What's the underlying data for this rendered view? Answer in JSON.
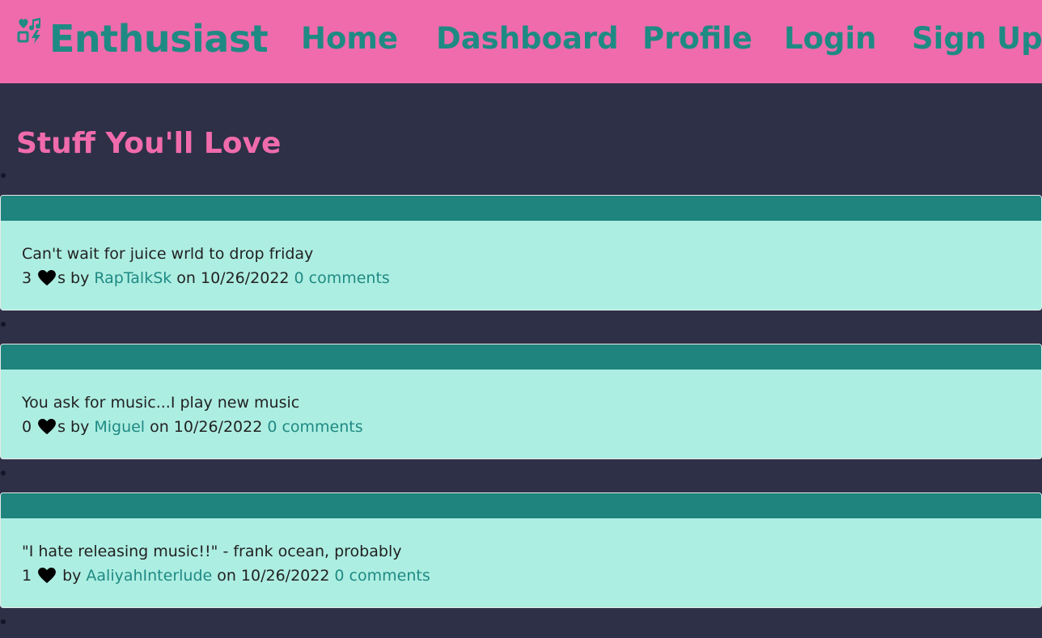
{
  "navbar": {
    "brand": "Enthusiast",
    "links": [
      "Home",
      "Dashboard",
      "Profile",
      "Login",
      "Sign Up"
    ]
  },
  "main": {
    "title": "Stuff You'll Love",
    "posts": [
      {
        "text": "Can't wait for juice wrld to drop friday",
        "likes": "3",
        "likes_suffix": "s by",
        "author": "RapTalkSk",
        "on": "on 10/26/2022",
        "comments": "0 comments"
      },
      {
        "text": "You ask for music...I play new music",
        "likes": "0",
        "likes_suffix": "s by",
        "author": "Miguel",
        "on": "on 10/26/2022",
        "comments": "0 comments"
      },
      {
        "text": "\"I hate releasing music!!\" - frank ocean, probably",
        "likes": "1",
        "likes_suffix": "by",
        "author": "AaliyahInterlude",
        "on": "on 10/26/2022",
        "comments": "0 comments"
      }
    ]
  },
  "colors": {
    "navbar": "#f06bac",
    "accent": "#1f8a83",
    "background": "#2d3047",
    "card": "#adeee2",
    "card_header": "#1f837e"
  },
  "icons": {
    "brand": "heart-music-bolt-icon",
    "like": "heart-icon"
  }
}
